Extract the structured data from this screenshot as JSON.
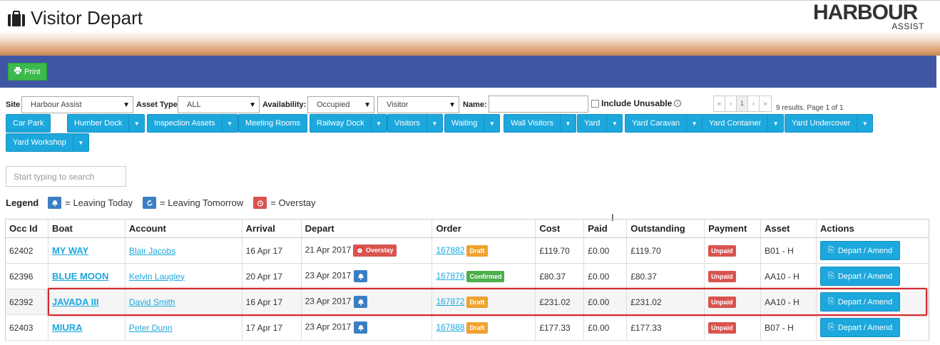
{
  "page": {
    "title": "Visitor Depart",
    "logo_main": "HARBOUR",
    "logo_sub": "ASSIST"
  },
  "toolbar": {
    "print_label": "Print"
  },
  "filters": {
    "site_label": "Site",
    "site_value": "Harbour Assist",
    "asset_type_label": "Asset Type",
    "asset_type_value": "ALL",
    "availability_label": "Availability:",
    "availability_value": "Occupied",
    "visitor_value": "Visitor",
    "name_label": "Name:",
    "include_unusable_label": "Include Unusable",
    "pager": {
      "first": "«",
      "prev": "‹",
      "page": "1",
      "next": "›",
      "last": "»"
    },
    "results_text": "9 results. Page 1 of 1"
  },
  "tabs": [
    {
      "label": "Car Park"
    },
    {
      "label": "Humber Dock"
    },
    {
      "label": "Inspection Assets"
    },
    {
      "label": "Meeting Rooms"
    },
    {
      "label": "Railway Dock"
    },
    {
      "label": "Visitors"
    },
    {
      "label": "Waiting"
    },
    {
      "label": "Wall Visitors"
    },
    {
      "label": "Yard"
    },
    {
      "label": "Yard Caravan"
    },
    {
      "label": "Yard Container"
    },
    {
      "label": "Yard Undercover"
    },
    {
      "label": "Yard Workshop"
    }
  ],
  "search": {
    "placeholder": "Start typing to search"
  },
  "legend": {
    "title": "Legend",
    "leaving_today": "= Leaving Today",
    "leaving_tomorrow": "= Leaving Tomorrow",
    "overstay": "= Overstay"
  },
  "table": {
    "headers": [
      "Occ Id",
      "Boat",
      "Account",
      "Arrival",
      "Depart",
      "Order",
      "Cost",
      "Paid",
      "Outstanding",
      "Payment",
      "Asset",
      "Actions"
    ],
    "rows": [
      {
        "occ_id": "62402",
        "boat": "MY WAY",
        "account": "Blair Jacobs",
        "arrival": "16 Apr 17",
        "depart": "21 Apr 2017",
        "depart_badge": "Overstay",
        "order": "167882",
        "order_status": "Draft",
        "cost": "£119.70",
        "paid": "£0.00",
        "outstanding": "£119.70",
        "payment": "Unpaid",
        "asset": "B01 - H",
        "action": "Depart / Amend"
      },
      {
        "occ_id": "62396",
        "boat": "BLUE MOON",
        "account": "Kelvin Laugley",
        "arrival": "20 Apr 17",
        "depart": "23 Apr 2017",
        "order": "167876",
        "order_status": "Confirmed",
        "cost": "£80.37",
        "paid": "£0.00",
        "outstanding": "£80.37",
        "payment": "Unpaid",
        "asset": "AA10 - H",
        "action": "Depart / Amend"
      },
      {
        "occ_id": "62392",
        "boat": "JAVADA III",
        "account": "David Smith",
        "arrival": "16 Apr 17",
        "depart": "23 Apr 2017",
        "order": "167872",
        "order_status": "Draft",
        "cost": "£231.02",
        "paid": "£0.00",
        "outstanding": "£231.02",
        "payment": "Unpaid",
        "asset": "AA10 - H",
        "action": "Depart / Amend"
      },
      {
        "occ_id": "62403",
        "boat": "MIURA",
        "account": "Peter Dunn",
        "arrival": "17 Apr 17",
        "depart": "23 Apr 2017",
        "order": "167888",
        "order_status": "Draft",
        "cost": "£177.33",
        "paid": "£0.00",
        "outstanding": "£177.33",
        "payment": "Unpaid",
        "asset": "B07 - H",
        "action": "Depart / Amend"
      }
    ]
  },
  "colors": {
    "nav_blue": "#3f57a3",
    "button_cyan": "#1ca8dd",
    "print_green": "#3dba4e",
    "draft_orange": "#f0a12f",
    "confirmed_green": "#4cae4c",
    "danger_red": "#d9534f",
    "highlight_red": "#d0282e"
  }
}
